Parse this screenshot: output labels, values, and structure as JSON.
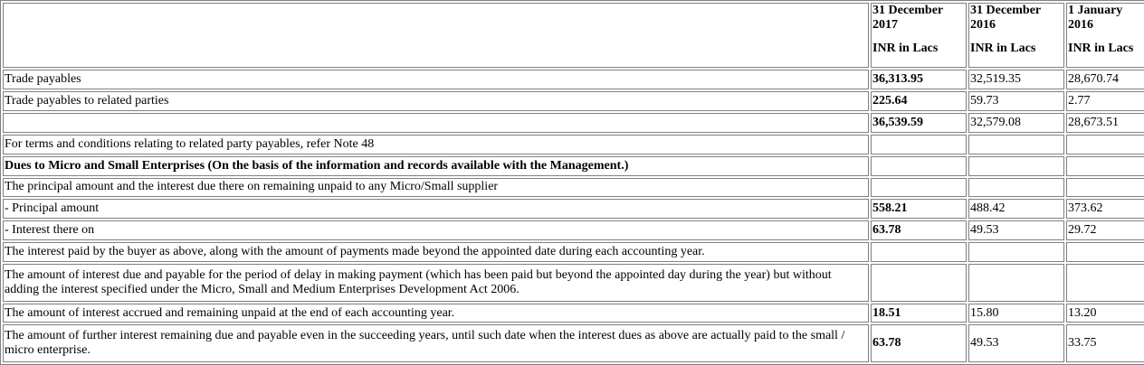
{
  "headers": {
    "col1": {
      "date": "31 December 2017",
      "unit": "INR in Lacs"
    },
    "col2": {
      "date": "31 December 2016",
      "unit": "INR in Lacs"
    },
    "col3": {
      "date": "1 January 2016",
      "unit": "INR in Lacs"
    }
  },
  "rows": [
    {
      "label": "Trade payables",
      "v1": "36,313.95",
      "v2": "32,519.35",
      "v3": "28,670.74"
    },
    {
      "label": "Trade payables to related parties",
      "v1": "225.64",
      "v2": "59.73",
      "v3": "2.77"
    },
    {
      "label": "",
      "v1": "36,539.59",
      "v2": "32,579.08",
      "v3": "28,673.51"
    },
    {
      "label": "For terms and conditions relating to related party payables, refer Note 48",
      "v1": "",
      "v2": "",
      "v3": ""
    },
    {
      "label": "Dues to Micro and Small Enterprises (On the basis of the information and records available with the Management.)",
      "v1": "",
      "v2": "",
      "v3": ""
    },
    {
      "label": "The principal amount and the interest due there on remaining unpaid to any Micro/Small supplier",
      "v1": "",
      "v2": "",
      "v3": ""
    },
    {
      "label": "- Principal amount",
      "v1": "558.21",
      "v2": "488.42",
      "v3": "373.62"
    },
    {
      "label": "- Interest there on",
      "v1": "63.78",
      "v2": "49.53",
      "v3": "29.72"
    },
    {
      "label": "The interest paid by the buyer as above, along with the amount of payments made beyond the appointed date during each accounting year.",
      "v1": "",
      "v2": "",
      "v3": ""
    },
    {
      "label": "The amount of interest due and payable for the period of delay in making payment (which has been paid but beyond the appointed day during the year) but without adding the interest specified under the Micro, Small and Medium Enterprises Development Act 2006.",
      "v1": "",
      "v2": "",
      "v3": ""
    },
    {
      "label": "The amount of interest accrued and remaining unpaid at the end of each accounting year.",
      "v1": "18.51",
      "v2": "15.80",
      "v3": "13.20"
    },
    {
      "label": "The amount of further interest remaining due and payable even in the succeeding years, until such date when the interest dues as above are actually paid to the small / micro enterprise.",
      "v1": "63.78",
      "v2": "49.53",
      "v3": "33.75"
    }
  ]
}
